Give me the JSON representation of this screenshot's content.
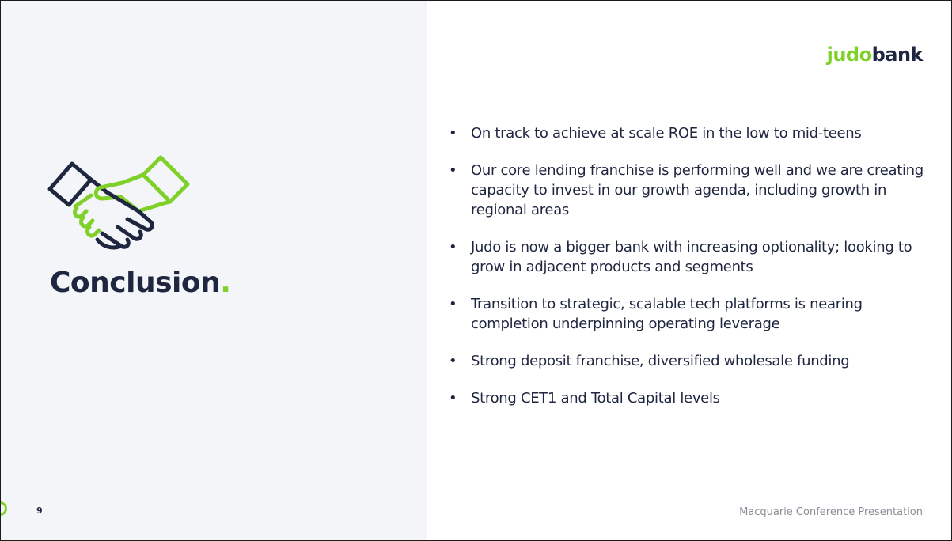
{
  "slide": {
    "title": "Conclusion",
    "title_dot": ".",
    "page_number": "9",
    "footer": "Macquarie Conference Presentation",
    "logo": {
      "part1": "judo",
      "part2": "bank"
    },
    "icon": "handshake-icon",
    "bullets": [
      "On track to achieve at scale ROE in the low to mid-teens",
      "Our core lending franchise is performing well and we are creating capacity to invest in our growth agenda, including growth in regional areas",
      "Judo is now a bigger bank with increasing optionality; looking to grow in adjacent products and segments",
      "Transition to strategic, scalable tech platforms is nearing completion underpinning operating leverage",
      "Strong deposit franchise, diversified wholesale funding",
      "Strong CET1 and Total Capital levels"
    ],
    "bullet_symbol": "•"
  },
  "colors": {
    "accent": "#7fd12a",
    "navy": "#1f2640",
    "left_panel_bg": "#f3f5f8",
    "footer_grey": "#8a8d96"
  }
}
